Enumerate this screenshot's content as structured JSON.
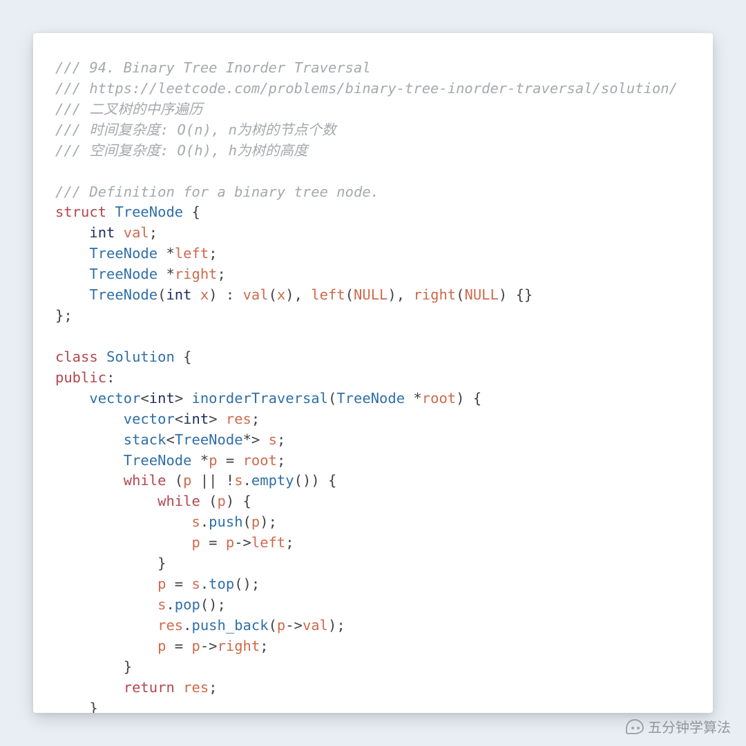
{
  "code": {
    "comments": {
      "c1": "/// 94. Binary Tree Inorder Traversal",
      "c2": "/// https://leetcode.com/problems/binary-tree-inorder-traversal/solution/",
      "c3": "/// 二叉树的中序遍历",
      "c4": "/// 时间复杂度: O(n), n为树的节点个数",
      "c5": "/// 空间复杂度: O(h), h为树的高度",
      "c6": "/// Definition for a binary tree node."
    },
    "keywords": {
      "struct": "struct",
      "class": "class",
      "public": "public",
      "return": "return",
      "while": "while",
      "int": "int"
    },
    "identifiers": {
      "TreeNode": "TreeNode",
      "Solution": "Solution",
      "val": "val",
      "left": "left",
      "right": "right",
      "x": "x",
      "NULL": "NULL",
      "vector": "vector",
      "stack": "stack",
      "inorderTraversal": "inorderTraversal",
      "root": "root",
      "res": "res",
      "s": "s",
      "p": "p",
      "empty": "empty",
      "push": "push",
      "top": "top",
      "pop": "pop",
      "push_back": "push_back"
    },
    "punct": {
      "lbrace": "{",
      "rbrace": "}",
      "lparen": "(",
      "rparen": ")",
      "lt": "<",
      "gt": ">",
      "semi": ";",
      "colon": ":",
      "comma": ",",
      "star": "*",
      "eq": "=",
      "excl": "!",
      "dot": ".",
      "or": "||",
      "arrow": "->",
      "braces": "{}",
      "parens": "()",
      "rbrace_semi": "};"
    }
  },
  "watermark": {
    "text": "五分钟学算法"
  }
}
